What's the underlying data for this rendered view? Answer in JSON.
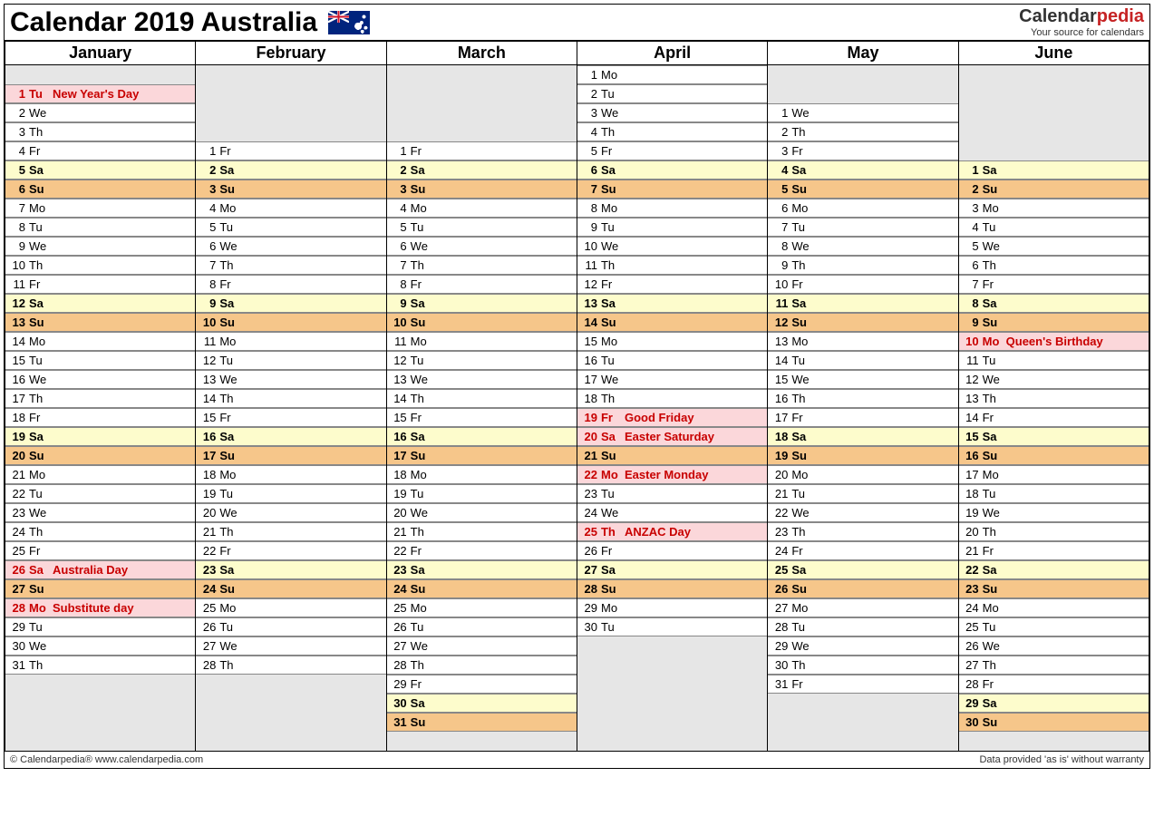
{
  "title": "Calendar 2019 Australia",
  "brand": {
    "prefix": "Calendar",
    "suffix": "pedia",
    "tagline": "Your source for calendars"
  },
  "footer": {
    "left": "© Calendarpedia®   www.calendarpedia.com",
    "right": "Data provided 'as is' without warranty"
  },
  "rows": 36,
  "months": [
    {
      "name": "January",
      "start": 1,
      "days": [
        {
          "n": 1,
          "d": "Tu",
          "t": "hol",
          "e": "New Year's Day"
        },
        {
          "n": 2,
          "d": "We"
        },
        {
          "n": 3,
          "d": "Th"
        },
        {
          "n": 4,
          "d": "Fr"
        },
        {
          "n": 5,
          "d": "Sa",
          "t": "sat"
        },
        {
          "n": 6,
          "d": "Su",
          "t": "sun"
        },
        {
          "n": 7,
          "d": "Mo"
        },
        {
          "n": 8,
          "d": "Tu"
        },
        {
          "n": 9,
          "d": "We"
        },
        {
          "n": 10,
          "d": "Th"
        },
        {
          "n": 11,
          "d": "Fr"
        },
        {
          "n": 12,
          "d": "Sa",
          "t": "sat"
        },
        {
          "n": 13,
          "d": "Su",
          "t": "sun"
        },
        {
          "n": 14,
          "d": "Mo"
        },
        {
          "n": 15,
          "d": "Tu"
        },
        {
          "n": 16,
          "d": "We"
        },
        {
          "n": 17,
          "d": "Th"
        },
        {
          "n": 18,
          "d": "Fr"
        },
        {
          "n": 19,
          "d": "Sa",
          "t": "sat"
        },
        {
          "n": 20,
          "d": "Su",
          "t": "sun"
        },
        {
          "n": 21,
          "d": "Mo"
        },
        {
          "n": 22,
          "d": "Tu"
        },
        {
          "n": 23,
          "d": "We"
        },
        {
          "n": 24,
          "d": "Th"
        },
        {
          "n": 25,
          "d": "Fr"
        },
        {
          "n": 26,
          "d": "Sa",
          "t": "hol",
          "e": "Australia Day"
        },
        {
          "n": 27,
          "d": "Su",
          "t": "sun"
        },
        {
          "n": 28,
          "d": "Mo",
          "t": "hol",
          "e": "Substitute day"
        },
        {
          "n": 29,
          "d": "Tu"
        },
        {
          "n": 30,
          "d": "We"
        },
        {
          "n": 31,
          "d": "Th"
        }
      ]
    },
    {
      "name": "February",
      "start": 4,
      "days": [
        {
          "n": 1,
          "d": "Fr"
        },
        {
          "n": 2,
          "d": "Sa",
          "t": "sat"
        },
        {
          "n": 3,
          "d": "Su",
          "t": "sun"
        },
        {
          "n": 4,
          "d": "Mo"
        },
        {
          "n": 5,
          "d": "Tu"
        },
        {
          "n": 6,
          "d": "We"
        },
        {
          "n": 7,
          "d": "Th"
        },
        {
          "n": 8,
          "d": "Fr"
        },
        {
          "n": 9,
          "d": "Sa",
          "t": "sat"
        },
        {
          "n": 10,
          "d": "Su",
          "t": "sun"
        },
        {
          "n": 11,
          "d": "Mo"
        },
        {
          "n": 12,
          "d": "Tu"
        },
        {
          "n": 13,
          "d": "We"
        },
        {
          "n": 14,
          "d": "Th"
        },
        {
          "n": 15,
          "d": "Fr"
        },
        {
          "n": 16,
          "d": "Sa",
          "t": "sat"
        },
        {
          "n": 17,
          "d": "Su",
          "t": "sun"
        },
        {
          "n": 18,
          "d": "Mo"
        },
        {
          "n": 19,
          "d": "Tu"
        },
        {
          "n": 20,
          "d": "We"
        },
        {
          "n": 21,
          "d": "Th"
        },
        {
          "n": 22,
          "d": "Fr"
        },
        {
          "n": 23,
          "d": "Sa",
          "t": "sat"
        },
        {
          "n": 24,
          "d": "Su",
          "t": "sun"
        },
        {
          "n": 25,
          "d": "Mo"
        },
        {
          "n": 26,
          "d": "Tu"
        },
        {
          "n": 27,
          "d": "We"
        },
        {
          "n": 28,
          "d": "Th"
        }
      ]
    },
    {
      "name": "March",
      "start": 4,
      "days": [
        {
          "n": 1,
          "d": "Fr"
        },
        {
          "n": 2,
          "d": "Sa",
          "t": "sat"
        },
        {
          "n": 3,
          "d": "Su",
          "t": "sun"
        },
        {
          "n": 4,
          "d": "Mo"
        },
        {
          "n": 5,
          "d": "Tu"
        },
        {
          "n": 6,
          "d": "We"
        },
        {
          "n": 7,
          "d": "Th"
        },
        {
          "n": 8,
          "d": "Fr"
        },
        {
          "n": 9,
          "d": "Sa",
          "t": "sat"
        },
        {
          "n": 10,
          "d": "Su",
          "t": "sun"
        },
        {
          "n": 11,
          "d": "Mo"
        },
        {
          "n": 12,
          "d": "Tu"
        },
        {
          "n": 13,
          "d": "We"
        },
        {
          "n": 14,
          "d": "Th"
        },
        {
          "n": 15,
          "d": "Fr"
        },
        {
          "n": 16,
          "d": "Sa",
          "t": "sat"
        },
        {
          "n": 17,
          "d": "Su",
          "t": "sun"
        },
        {
          "n": 18,
          "d": "Mo"
        },
        {
          "n": 19,
          "d": "Tu"
        },
        {
          "n": 20,
          "d": "We"
        },
        {
          "n": 21,
          "d": "Th"
        },
        {
          "n": 22,
          "d": "Fr"
        },
        {
          "n": 23,
          "d": "Sa",
          "t": "sat"
        },
        {
          "n": 24,
          "d": "Su",
          "t": "sun"
        },
        {
          "n": 25,
          "d": "Mo"
        },
        {
          "n": 26,
          "d": "Tu"
        },
        {
          "n": 27,
          "d": "We"
        },
        {
          "n": 28,
          "d": "Th"
        },
        {
          "n": 29,
          "d": "Fr"
        },
        {
          "n": 30,
          "d": "Sa",
          "t": "sat"
        },
        {
          "n": 31,
          "d": "Su",
          "t": "sun"
        }
      ]
    },
    {
      "name": "April",
      "start": 0,
      "days": [
        {
          "n": 1,
          "d": "Mo"
        },
        {
          "n": 2,
          "d": "Tu"
        },
        {
          "n": 3,
          "d": "We"
        },
        {
          "n": 4,
          "d": "Th"
        },
        {
          "n": 5,
          "d": "Fr"
        },
        {
          "n": 6,
          "d": "Sa",
          "t": "sat"
        },
        {
          "n": 7,
          "d": "Su",
          "t": "sun"
        },
        {
          "n": 8,
          "d": "Mo"
        },
        {
          "n": 9,
          "d": "Tu"
        },
        {
          "n": 10,
          "d": "We"
        },
        {
          "n": 11,
          "d": "Th"
        },
        {
          "n": 12,
          "d": "Fr"
        },
        {
          "n": 13,
          "d": "Sa",
          "t": "sat"
        },
        {
          "n": 14,
          "d": "Su",
          "t": "sun"
        },
        {
          "n": 15,
          "d": "Mo"
        },
        {
          "n": 16,
          "d": "Tu"
        },
        {
          "n": 17,
          "d": "We"
        },
        {
          "n": 18,
          "d": "Th"
        },
        {
          "n": 19,
          "d": "Fr",
          "t": "hol",
          "e": "Good Friday"
        },
        {
          "n": 20,
          "d": "Sa",
          "t": "hol",
          "e": "Easter Saturday"
        },
        {
          "n": 21,
          "d": "Su",
          "t": "sun"
        },
        {
          "n": 22,
          "d": "Mo",
          "t": "hol",
          "e": "Easter Monday"
        },
        {
          "n": 23,
          "d": "Tu"
        },
        {
          "n": 24,
          "d": "We"
        },
        {
          "n": 25,
          "d": "Th",
          "t": "hol",
          "e": "ANZAC Day"
        },
        {
          "n": 26,
          "d": "Fr"
        },
        {
          "n": 27,
          "d": "Sa",
          "t": "sat"
        },
        {
          "n": 28,
          "d": "Su",
          "t": "sun"
        },
        {
          "n": 29,
          "d": "Mo"
        },
        {
          "n": 30,
          "d": "Tu"
        }
      ]
    },
    {
      "name": "May",
      "start": 2,
      "days": [
        {
          "n": 1,
          "d": "We"
        },
        {
          "n": 2,
          "d": "Th"
        },
        {
          "n": 3,
          "d": "Fr"
        },
        {
          "n": 4,
          "d": "Sa",
          "t": "sat"
        },
        {
          "n": 5,
          "d": "Su",
          "t": "sun"
        },
        {
          "n": 6,
          "d": "Mo"
        },
        {
          "n": 7,
          "d": "Tu"
        },
        {
          "n": 8,
          "d": "We"
        },
        {
          "n": 9,
          "d": "Th"
        },
        {
          "n": 10,
          "d": "Fr"
        },
        {
          "n": 11,
          "d": "Sa",
          "t": "sat"
        },
        {
          "n": 12,
          "d": "Su",
          "t": "sun"
        },
        {
          "n": 13,
          "d": "Mo"
        },
        {
          "n": 14,
          "d": "Tu"
        },
        {
          "n": 15,
          "d": "We"
        },
        {
          "n": 16,
          "d": "Th"
        },
        {
          "n": 17,
          "d": "Fr"
        },
        {
          "n": 18,
          "d": "Sa",
          "t": "sat"
        },
        {
          "n": 19,
          "d": "Su",
          "t": "sun"
        },
        {
          "n": 20,
          "d": "Mo"
        },
        {
          "n": 21,
          "d": "Tu"
        },
        {
          "n": 22,
          "d": "We"
        },
        {
          "n": 23,
          "d": "Th"
        },
        {
          "n": 24,
          "d": "Fr"
        },
        {
          "n": 25,
          "d": "Sa",
          "t": "sat"
        },
        {
          "n": 26,
          "d": "Su",
          "t": "sun"
        },
        {
          "n": 27,
          "d": "Mo"
        },
        {
          "n": 28,
          "d": "Tu"
        },
        {
          "n": 29,
          "d": "We"
        },
        {
          "n": 30,
          "d": "Th"
        },
        {
          "n": 31,
          "d": "Fr"
        }
      ]
    },
    {
      "name": "June",
      "start": 5,
      "days": [
        {
          "n": 1,
          "d": "Sa",
          "t": "sat"
        },
        {
          "n": 2,
          "d": "Su",
          "t": "sun"
        },
        {
          "n": 3,
          "d": "Mo"
        },
        {
          "n": 4,
          "d": "Tu"
        },
        {
          "n": 5,
          "d": "We"
        },
        {
          "n": 6,
          "d": "Th"
        },
        {
          "n": 7,
          "d": "Fr"
        },
        {
          "n": 8,
          "d": "Sa",
          "t": "sat"
        },
        {
          "n": 9,
          "d": "Su",
          "t": "sun"
        },
        {
          "n": 10,
          "d": "Mo",
          "t": "hol",
          "e": "Queen's Birthday"
        },
        {
          "n": 11,
          "d": "Tu"
        },
        {
          "n": 12,
          "d": "We"
        },
        {
          "n": 13,
          "d": "Th"
        },
        {
          "n": 14,
          "d": "Fr"
        },
        {
          "n": 15,
          "d": "Sa",
          "t": "sat"
        },
        {
          "n": 16,
          "d": "Su",
          "t": "sun"
        },
        {
          "n": 17,
          "d": "Mo"
        },
        {
          "n": 18,
          "d": "Tu"
        },
        {
          "n": 19,
          "d": "We"
        },
        {
          "n": 20,
          "d": "Th"
        },
        {
          "n": 21,
          "d": "Fr"
        },
        {
          "n": 22,
          "d": "Sa",
          "t": "sat"
        },
        {
          "n": 23,
          "d": "Su",
          "t": "sun"
        },
        {
          "n": 24,
          "d": "Mo"
        },
        {
          "n": 25,
          "d": "Tu"
        },
        {
          "n": 26,
          "d": "We"
        },
        {
          "n": 27,
          "d": "Th"
        },
        {
          "n": 28,
          "d": "Fr"
        },
        {
          "n": 29,
          "d": "Sa",
          "t": "sat"
        },
        {
          "n": 30,
          "d": "Su",
          "t": "sun"
        }
      ]
    }
  ]
}
